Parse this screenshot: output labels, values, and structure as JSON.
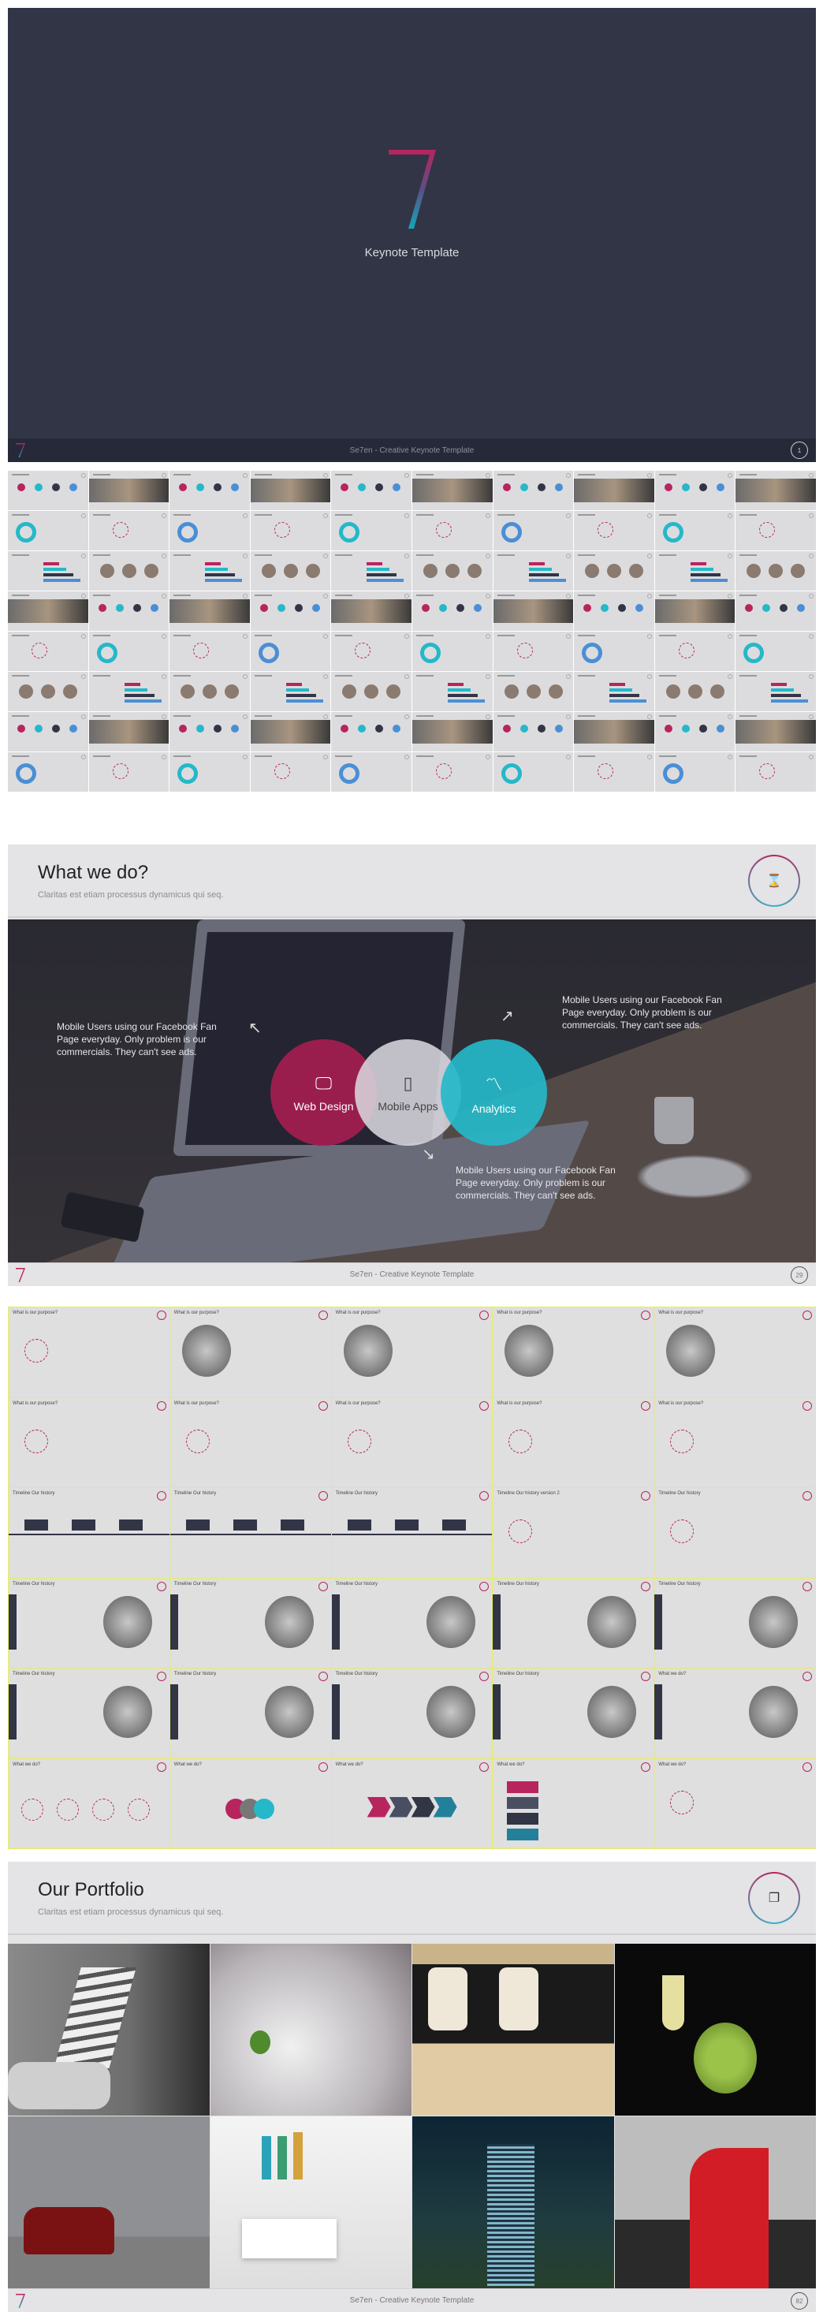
{
  "title_slide": {
    "logo": "7",
    "title": "Keynote Template",
    "footer_text": "Se7en - Creative Keynote Template",
    "page_number": "1"
  },
  "what_we_do": {
    "title": "What we do?",
    "subtitle": "Claritas est etiam processus dynamicus qui seq.",
    "header_icon": "hourglass-icon",
    "services": [
      {
        "label": "Web Design",
        "icon": "monitor-icon",
        "color": "#a01f50"
      },
      {
        "label": "Mobile Apps",
        "icon": "smartphone-icon",
        "color": "#d5d3d8"
      },
      {
        "label": "Analytics",
        "icon": "chart-line-icon",
        "color": "#25b8c9"
      }
    ],
    "callouts": [
      "Mobile Users using our Facebook Fan Page everyday. Only problem is our commercials. They can't see ads.",
      "Mobile Users using our Facebook Fan Page everyday. Only problem is our commercials. They can't see ads.",
      "Mobile Users using our Facebook Fan Page everyday. Only problem is our commercials. They can't see ads."
    ],
    "footer_text": "Se7en - Creative Keynote Template",
    "page_number": "29"
  },
  "slide_grid": {
    "titles": [
      "What is our purpose?",
      "Timeline Our history",
      "Timeline Our history version 2",
      "What we do?"
    ]
  },
  "portfolio": {
    "title": "Our Portfolio",
    "subtitle": "Claritas est etiam processus dynamicus qui seq.",
    "header_icon": "cards-icon",
    "footer_text": "Se7en - Creative Keynote Template",
    "page_number": "82"
  },
  "colors": {
    "dark": "#323546",
    "magenta": "#b8245e",
    "cyan": "#25b8c9",
    "highlight_border": "#e6ef5a"
  }
}
